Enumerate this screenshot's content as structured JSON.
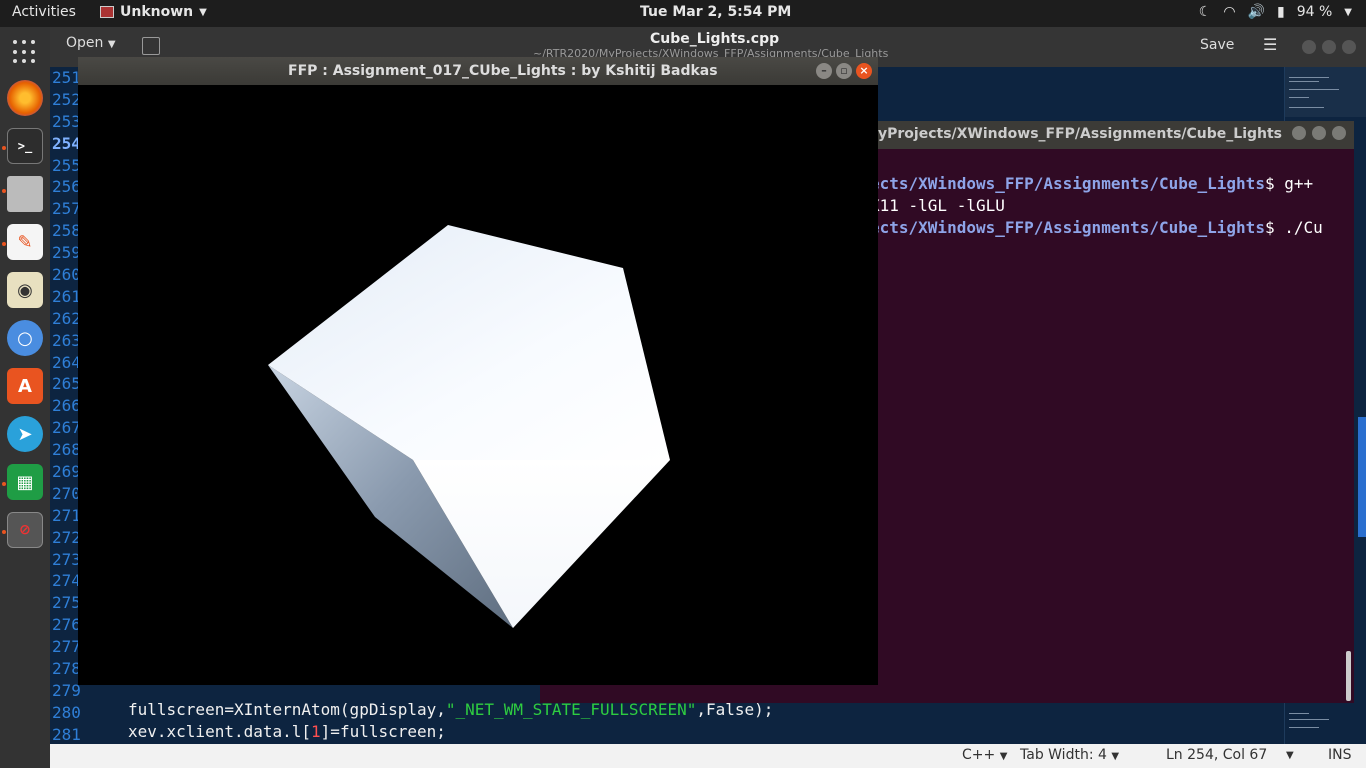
{
  "topbar": {
    "activities": "Activities",
    "app_name": "Unknown",
    "clock": "Tue Mar  2,  5:54 PM",
    "battery": "94 %"
  },
  "dock": {
    "apps": [
      "show-apps",
      "firefox",
      "terminal",
      "files",
      "text-editor",
      "rhythmbox",
      "chromium",
      "software-center",
      "telegram",
      "spreadsheet",
      "opengl-app"
    ]
  },
  "gedit": {
    "open_label": "Open",
    "file_title": "Cube_Lights.cpp",
    "file_path": "~/RTR2020/MyProjects/XWindows_FFP/Assignments/Cube_Lights",
    "save_label": "Save",
    "line_numbers": [
      "251",
      "252",
      "253",
      "254",
      "255",
      "256",
      "257",
      "258",
      "259",
      "260",
      "261",
      "262",
      "263",
      "264",
      "265",
      "266",
      "267",
      "268",
      "269",
      "270",
      "271",
      "272",
      "273",
      "274",
      "275",
      "276",
      "277",
      "278",
      "279",
      "280",
      "281"
    ],
    "current_line": "254",
    "code_line_280_a": "fullscreen=XInternAtom(gpDisplay,",
    "code_line_280_str": "\"_NET_WM_STATE_FULLSCREEN\"",
    "code_line_280_b": ",False);",
    "code_line_281_a": "xev.xclient.data.l[",
    "code_line_281_num": "1",
    "code_line_281_b": "]=fullscreen;",
    "status": {
      "language": "C++",
      "tab_width": "Tab Width: 4",
      "position": "Ln 254, Col 67",
      "mode": "INS"
    }
  },
  "terminal": {
    "title": "yProjects/XWindows_FFP/Assignments/Cube_Lights",
    "line1_path": "ects/XWindows_FFP/Assignments/Cube_Lights",
    "line1_cmd": "$ g++",
    "line2": "X11 -lGL -lGLU",
    "line3_path": "ects/XWindows_FFP/Assignments/Cube_Lights",
    "line3_cmd": "$ ./Cu"
  },
  "gl_window": {
    "title": "FFP : Assignment_017_CUbe_Lights : by Kshitij Badkas"
  }
}
